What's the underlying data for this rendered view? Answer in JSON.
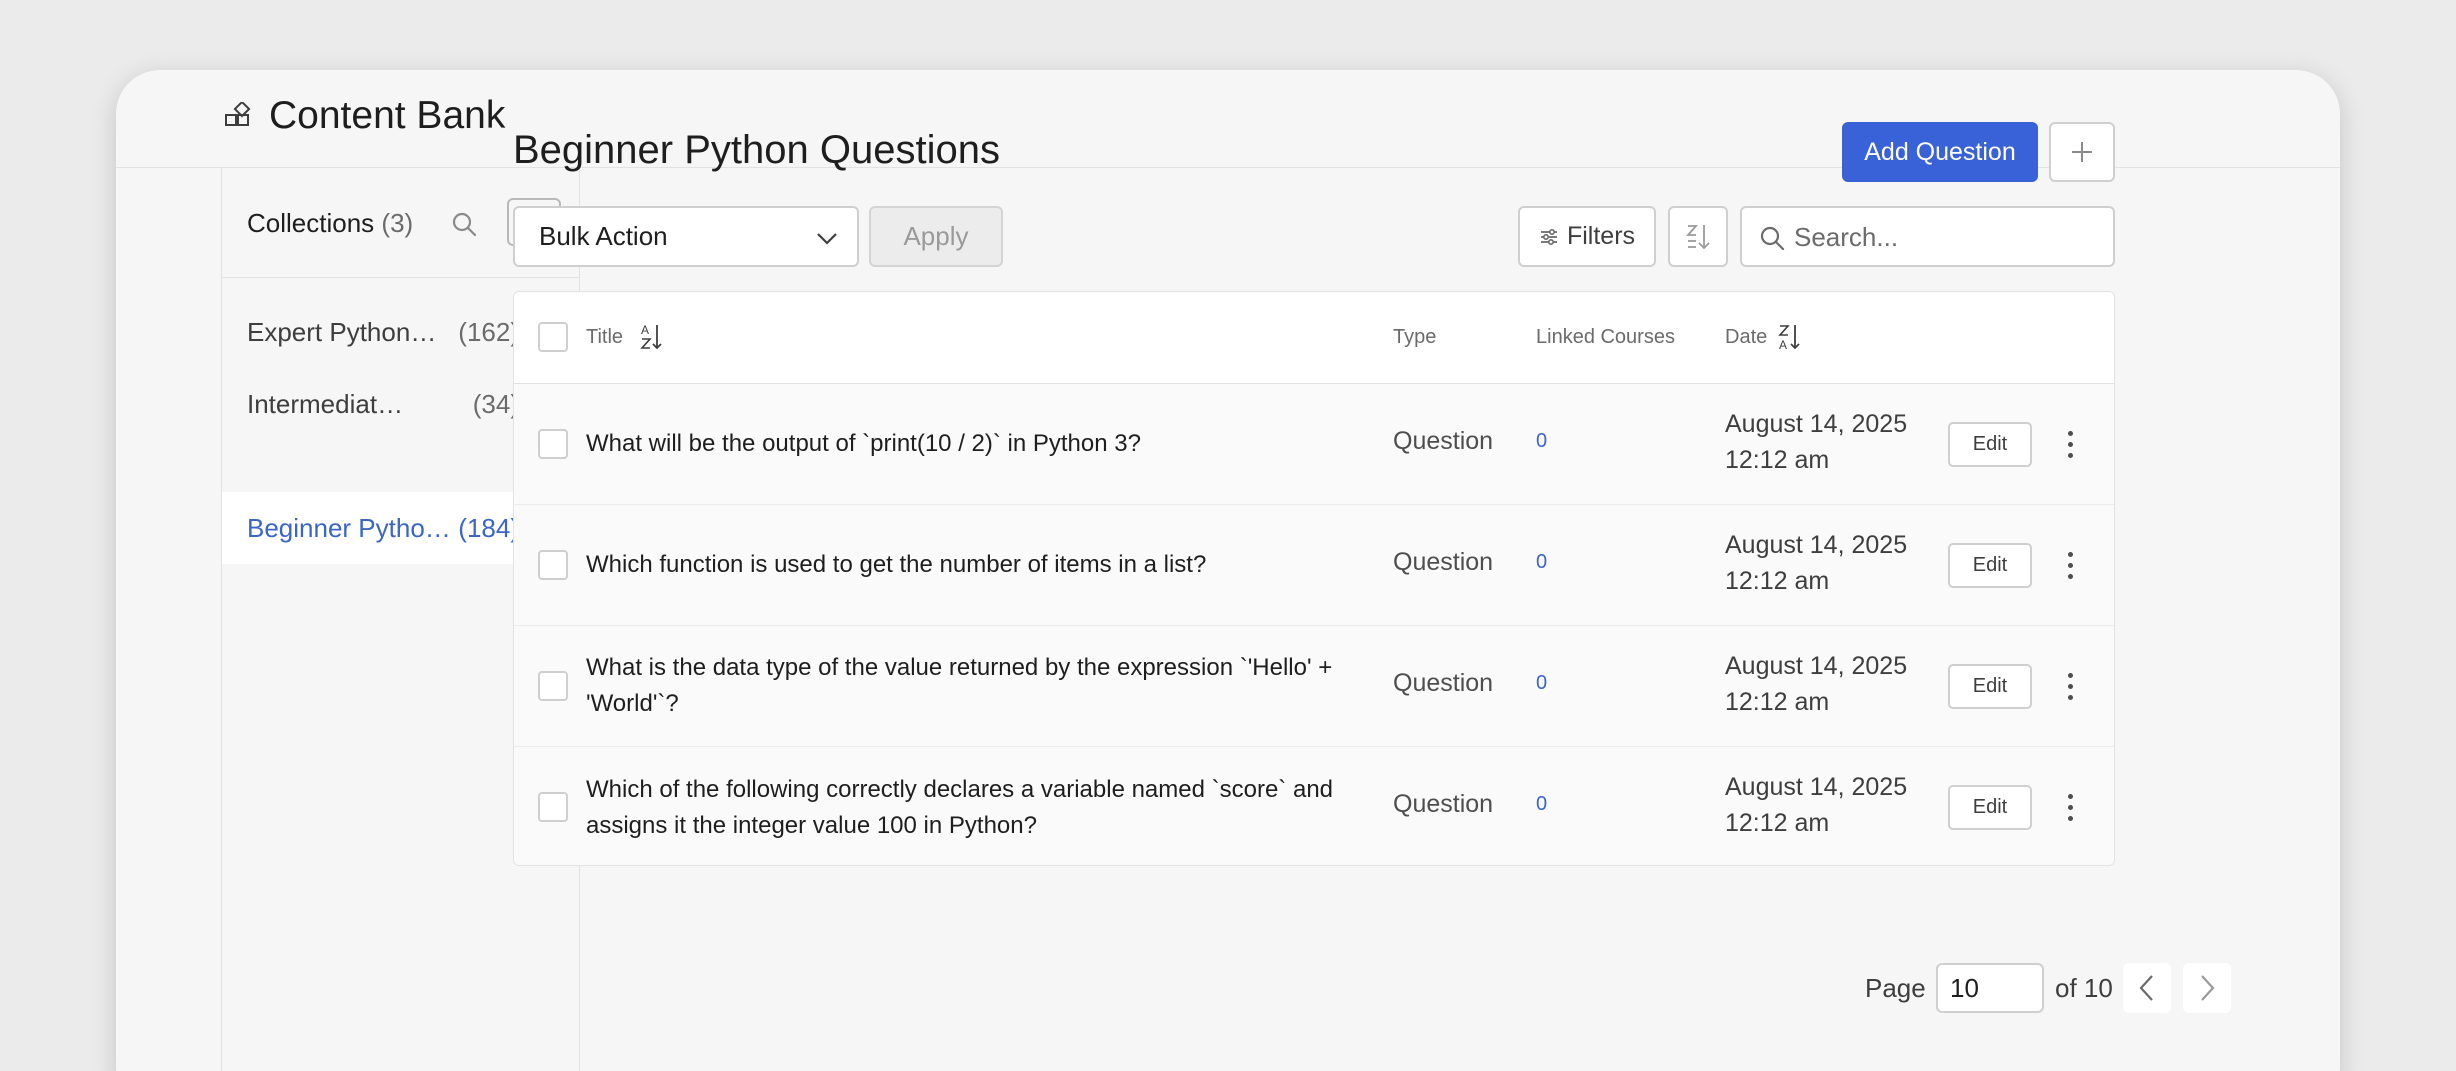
{
  "app": {
    "title": "Content Bank"
  },
  "sidebar": {
    "title": "Collections",
    "count": "(3)",
    "items": [
      {
        "label": "Expert Python Questions",
        "count": "(162)"
      },
      {
        "label": "Intermediate Python Questions",
        "count": "(34)"
      },
      {
        "label": "Beginner Python Questions",
        "count": "(184)"
      }
    ],
    "active_index": 2
  },
  "main": {
    "title": "Beginner Python Questions",
    "add_button": "Add Question",
    "bulk_action": "Bulk Action",
    "apply_button": "Apply",
    "filters_button": "Filters",
    "search_placeholder": "Search..."
  },
  "table": {
    "columns": {
      "title": "Title",
      "type": "Type",
      "linked": "Linked Courses",
      "date": "Date"
    },
    "rows": [
      {
        "title": "What will be the output of `print(10 / 2)` in Python 3?",
        "type": "Question",
        "linked": "0",
        "date": "August 14, 2025",
        "time": "12:12 am",
        "action": "Edit"
      },
      {
        "title": "Which function is used to get the number of items in a list?",
        "type": "Question",
        "linked": "0",
        "date": "August 14, 2025",
        "time": "12:12 am",
        "action": "Edit"
      },
      {
        "title": "What is the data type of the value returned by the expression `'Hello' + 'World'`?",
        "type": "Question",
        "linked": "0",
        "date": "August 14, 2025",
        "time": "12:12 am",
        "action": "Edit"
      },
      {
        "title": "Which of the following correctly declares a variable named `score` and assigns it the integer value 100 in Python?",
        "type": "Question",
        "linked": "0",
        "date": "August 14, 2025",
        "time": "12:12 am",
        "action": "Edit"
      }
    ]
  },
  "pager": {
    "label": "Page",
    "value": "10",
    "of": "of 10"
  },
  "colors": {
    "accent": "#3a62d8",
    "active_link": "#3b66c4"
  },
  "icons": [
    "app-icon",
    "search-icon",
    "plus-icon",
    "chevron-down-icon",
    "filter-icon",
    "sort-icon",
    "more-vertical-icon",
    "chevron-left-icon",
    "chevron-right-icon"
  ]
}
